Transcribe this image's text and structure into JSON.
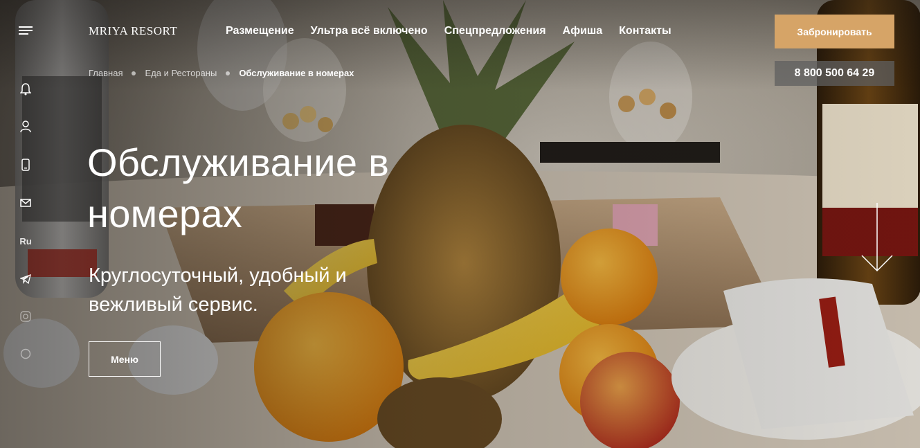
{
  "header": {
    "logo": "MRIYA RESORT",
    "nav": [
      "Размещение",
      "Ультра всё включено",
      "Спецпредложения",
      "Афиша",
      "Контакты"
    ],
    "book_label": "Забронировать",
    "phone": "8 800 500 64 29"
  },
  "rail": {
    "lang": "Ru",
    "icons": [
      "menu-icon",
      "bell-icon",
      "user-icon",
      "phone-icon",
      "mail-icon",
      "telegram-icon",
      "instagram-icon",
      "whatsapp-icon"
    ]
  },
  "breadcrumb": {
    "items": [
      "Главная",
      "Еда и Рестораны",
      "Обслуживание в номерах"
    ]
  },
  "hero": {
    "title_line1": "Обслуживание в",
    "title_line2": "номерах",
    "subtitle_line1": "Круглосуточный, удобный и",
    "subtitle_line2": "вежливый сервис.",
    "menu_label": "Меню"
  },
  "colors": {
    "accent": "#d6a467",
    "phone_bg": "#5f5f5f",
    "text": "#ffffff"
  }
}
